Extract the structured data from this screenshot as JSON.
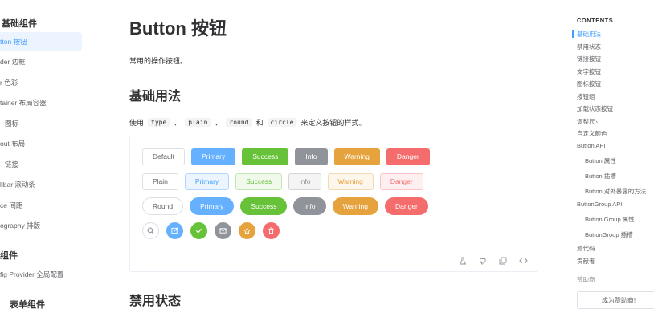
{
  "sidebar": {
    "group_basic": "基础组件",
    "items": [
      {
        "label": "tton 按钮",
        "active": true
      },
      {
        "label": "der 边框"
      },
      {
        "label": "r 色彩"
      },
      {
        "label": "tainer 布局容器"
      },
      {
        "label": "图标"
      },
      {
        "label": "out 布局"
      },
      {
        "label": "链接"
      },
      {
        "label": "llbar 滚动条"
      },
      {
        "label": "ce 间距"
      },
      {
        "label": "ography 排版"
      }
    ],
    "group_config": "组件",
    "config_item": "fig Provider 全局配置",
    "group_form": "表单组件"
  },
  "main": {
    "title": "Button 按钮",
    "desc": "常用的操作按钮。",
    "section_basic": "基础用法",
    "usage": {
      "prefix": "使用",
      "type": "type",
      "sep1": "、",
      "plain": "plain",
      "sep2": "、",
      "round": "round",
      "and": "和",
      "circle": "circle",
      "suffix": "来定义按钮的样式。"
    },
    "buttons": {
      "default": "Default",
      "plain_label": "Plain",
      "round_label": "Round",
      "primary": "Primary",
      "success": "Success",
      "info": "Info",
      "warning": "Warning",
      "danger": "Danger"
    },
    "footer_icons": [
      "flask-icon",
      "github-icon",
      "copy-icon",
      "code-icon"
    ],
    "section_disabled": "禁用状态"
  },
  "toc": {
    "title": "CONTENTS",
    "items": [
      {
        "label": "基础用法",
        "active": true
      },
      {
        "label": "禁用状态"
      },
      {
        "label": "链接按钮"
      },
      {
        "label": "文字按钮"
      },
      {
        "label": "图标按钮"
      },
      {
        "label": "按钮组"
      },
      {
        "label": "加载状态按钮"
      },
      {
        "label": "调整尺寸"
      },
      {
        "label": "自定义颜色"
      },
      {
        "label": "Button API"
      },
      {
        "label": "Button 属性",
        "sub": true
      },
      {
        "label": "Button 插槽",
        "sub": true
      },
      {
        "label": "Button 对外暴露的方法",
        "sub": true
      },
      {
        "label": "ButtonGroup API"
      },
      {
        "label": "Button Group 属性",
        "sub": true
      },
      {
        "label": "ButtonGroup 插槽",
        "sub": true
      },
      {
        "label": "源代码"
      },
      {
        "label": "贡献者"
      }
    ],
    "sponsor_label": "赞助商",
    "sponsor_button": "成为赞助商!"
  },
  "colors": {
    "primary": "#409eff",
    "success": "#67c23a",
    "info": "#909399",
    "warning": "#e6a23c",
    "danger": "#f56c6c"
  }
}
